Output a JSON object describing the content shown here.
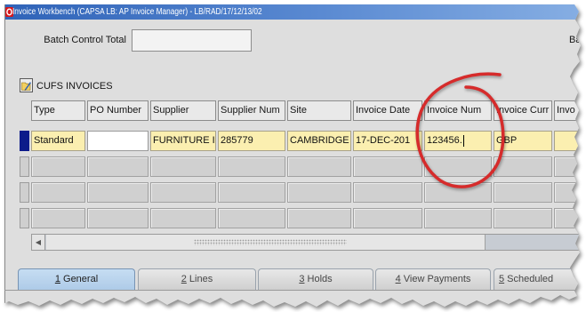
{
  "window": {
    "title": "Invoice Workbench (CAPSA LB: AP Invoice Manager) - LB/RAD/17/12/13/02",
    "title_icon": "oracle-window-icon"
  },
  "batch_control": {
    "label": "Batch Control Total",
    "value": "",
    "next_label_partial": "Ba"
  },
  "block": {
    "title": "CUFS INVOICES",
    "icon": "folder-edit-icon"
  },
  "table": {
    "columns": [
      "Type",
      "PO Number",
      "Supplier",
      "Supplier Num",
      "Site",
      "Invoice Date",
      "Invoice Num",
      "Invoice Curr",
      "Invo"
    ],
    "rows": [
      {
        "current": true,
        "cells": [
          "Standard",
          "",
          "FURNITURE I",
          "285779",
          "CAMBRIDGE",
          "17-DEC-201",
          "123456.",
          "GBP",
          ""
        ]
      },
      {
        "current": false,
        "cells": [
          "",
          "",
          "",
          "",
          "",
          "",
          "",
          "",
          ""
        ]
      },
      {
        "current": false,
        "cells": [
          "",
          "",
          "",
          "",
          "",
          "",
          "",
          "",
          ""
        ]
      },
      {
        "current": false,
        "cells": [
          "",
          "",
          "",
          "",
          "",
          "",
          "",
          "",
          ""
        ]
      }
    ]
  },
  "scrollbar": {
    "left_arrow_icon": "arrow-left-icon"
  },
  "tabs": [
    {
      "label": "1 General",
      "active": true
    },
    {
      "label": "2 Lines",
      "active": false
    },
    {
      "label": "3 Holds",
      "active": false
    },
    {
      "label": "4 View Payments",
      "active": false
    },
    {
      "label": "5 Scheduled",
      "active": false
    }
  ],
  "colors": {
    "title_bar": "#2f63b8",
    "required_field": "#fbefb0",
    "current_record": "#0c1b8a",
    "active_tab": "#aecbe8",
    "annotation": "#d62b2b"
  }
}
